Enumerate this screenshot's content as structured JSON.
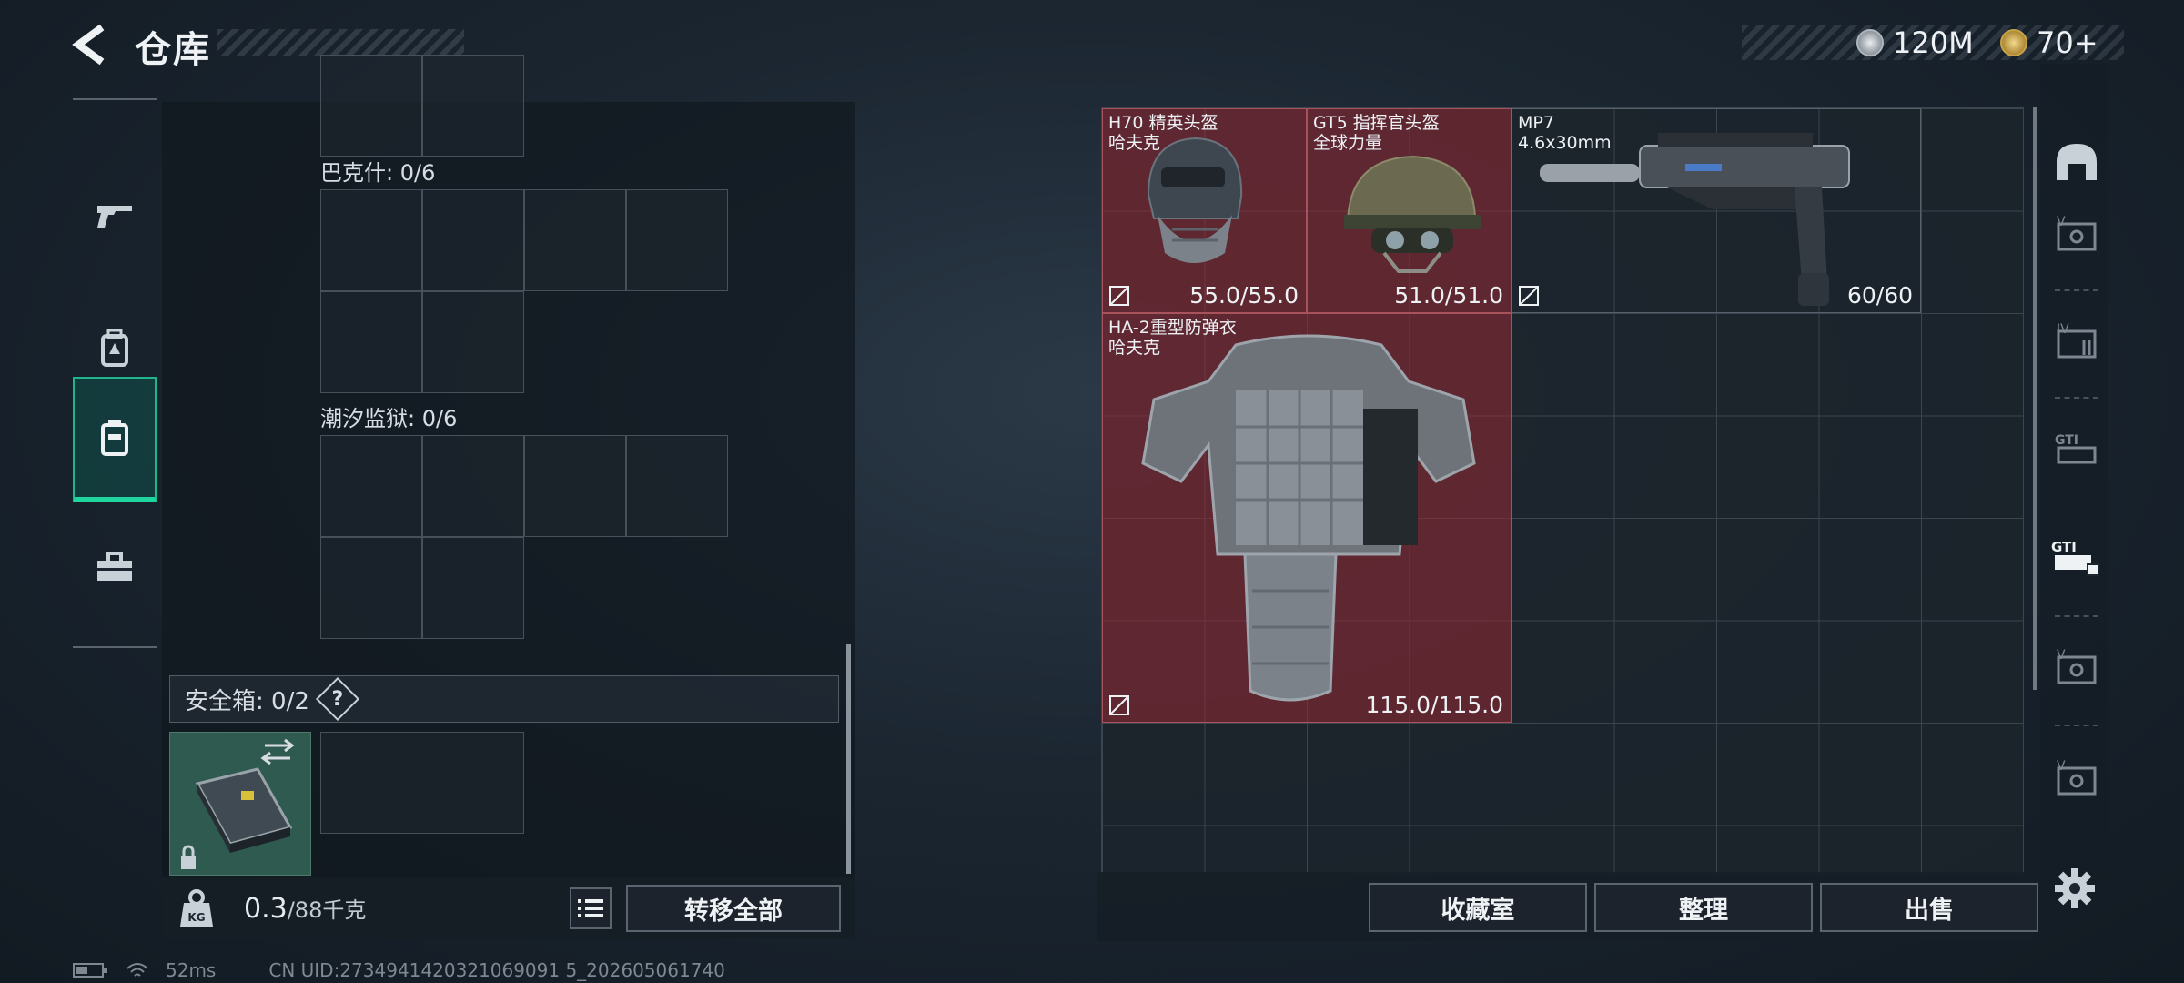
{
  "header": {
    "title": "仓库"
  },
  "currency": [
    {
      "icon": "silver-coin-icon",
      "value": "120M",
      "color": "#c9ced3"
    },
    {
      "icon": "gold-coin-icon",
      "value": "70+",
      "color": "#d4b35a"
    }
  ],
  "side_nav": [
    {
      "icon": "gun-icon",
      "active": false
    },
    {
      "icon": "backpack-icon",
      "active": false
    },
    {
      "icon": "chest-rig-icon",
      "active": true
    },
    {
      "icon": "toolbox-icon",
      "active": false
    }
  ],
  "left_panel": {
    "sections": [
      {
        "label": "巴克什: 0/6"
      },
      {
        "label": "潮汐监狱: 0/6"
      }
    ],
    "safe_box": {
      "label": "安全箱: 0/2",
      "help": "?"
    },
    "weight": {
      "current": "0.3",
      "max": "/88千克"
    },
    "transfer_all": "转移全部"
  },
  "stash_items": [
    {
      "name": "H70 精英头盔",
      "sub": "哈夫克",
      "durability": "55.0/55.0",
      "rarity": "red"
    },
    {
      "name": "GT5 指挥官头盔",
      "sub": "全球力量",
      "durability": "51.0/51.0",
      "rarity": "red"
    },
    {
      "name": "MP7",
      "sub": "4.6x30mm",
      "durability": "60/60",
      "rarity": "plain"
    },
    {
      "name": "HA-2重型防弹衣",
      "sub": "哈夫克",
      "durability": "115.0/115.0",
      "rarity": "red"
    }
  ],
  "rail_icons": [
    "helmet-filter-icon",
    "armor-v-icon",
    "armor-iv-icon",
    "gt1-icon",
    "gt1-plus-icon",
    "armor-v-icon-2",
    "armor-v-icon-3"
  ],
  "buttons": {
    "favorites": "收藏室",
    "sort": "整理",
    "sell": "出售"
  },
  "status": {
    "ping": "52ms",
    "uid": "CN UID:2734941420321069091 5_202605061740"
  },
  "colors": {
    "accent": "#1fd69f",
    "rarity_red": "#962a34"
  }
}
